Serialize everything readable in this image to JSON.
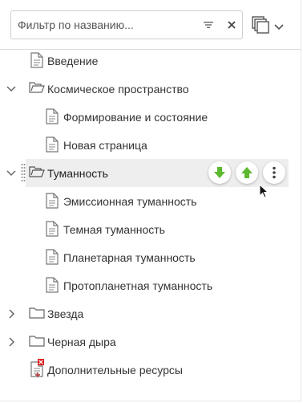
{
  "filter": {
    "placeholder": "Фильтр по названию..."
  },
  "icons": {
    "sort": "sort-filter-icon",
    "clear": "close-icon",
    "mode": "copy-pages-icon",
    "mode_chevron": "chevron-down-icon",
    "page": "page-icon",
    "folder": "folder-icon",
    "broken_page": "page-error-icon",
    "move_down": "arrow-down-icon",
    "move_up": "arrow-up-icon",
    "more": "more-vertical-icon"
  },
  "colors": {
    "arrow_green": "#5cb82e",
    "selected_bg": "#eeeeee",
    "error_red": "#e02020"
  },
  "tree": {
    "items": [
      {
        "label": "Введение",
        "type": "page",
        "level": 1
      },
      {
        "label": "Космическое пространство",
        "type": "folder",
        "level": 0,
        "expanded": true
      },
      {
        "label": "Формирование и состояние",
        "type": "page",
        "level": 2
      },
      {
        "label": "Новая страница",
        "type": "page",
        "level": 2
      },
      {
        "label": "Туманность",
        "type": "folder",
        "level": 0,
        "expanded": true,
        "selected": true
      },
      {
        "label": "Эмиссионная туманность",
        "type": "page",
        "level": 2
      },
      {
        "label": "Темная туманность",
        "type": "page",
        "level": 2
      },
      {
        "label": "Планетарная туманность",
        "type": "page",
        "level": 2
      },
      {
        "label": "Протопланетная туманность",
        "type": "page",
        "level": 2
      },
      {
        "label": "Звезда",
        "type": "folder",
        "level": 0,
        "expanded": false
      },
      {
        "label": "Черная дыра",
        "type": "folder",
        "level": 0,
        "expanded": false
      },
      {
        "label": "Дополнительные ресурсы",
        "type": "page-error",
        "level": 1
      }
    ]
  }
}
